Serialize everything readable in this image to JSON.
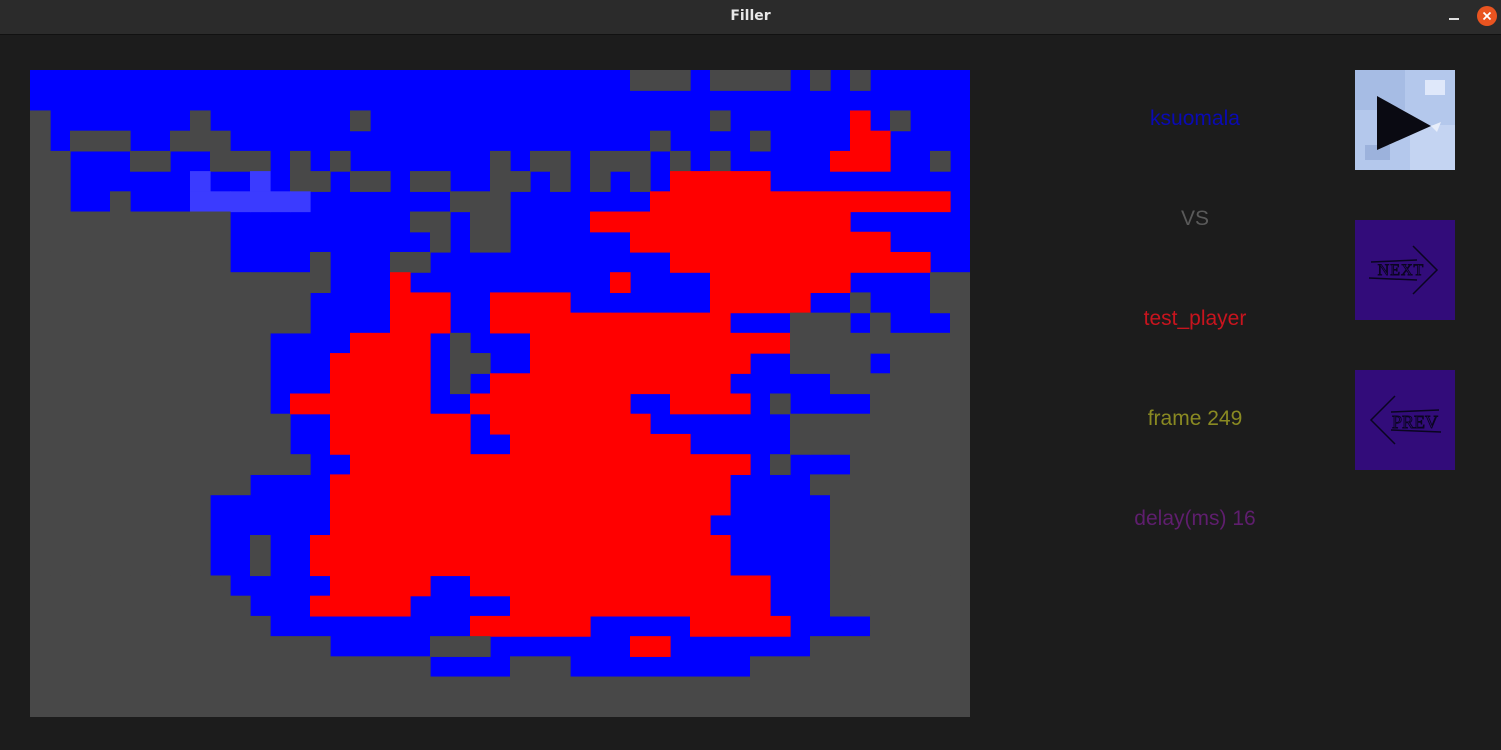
{
  "window": {
    "title": "Filler"
  },
  "board": {
    "columns": 47,
    "rows": 32,
    "colors": {
      "empty": "#484848",
      "player1": "#0000ff",
      "player2": "#ff0000",
      "last_piece": "#3b3bff"
    },
    "grid": [
      "..............................GGG.GGGG.G.G.....",
      "...............................................",
      "G.......G.......G.................G......R.G...",
      "G.GGG..GGG.....................G....G....RR....",
      "GG...GG..GGG.G.G.......G.GG.GGG.G.G.....RRR..G.",
      "GG......L..L.GG.GG.GG..GG.G.G.G.RRRRR..........",
      "GG..G...LLLLLL.......GGG.......RRRRRRRRRRRRRRR..",
      "GGGGGGGGGG.........GG.GG....RRRRRRRRRRRRR......",
      "GGGGGGGGGG..........G.GG......RRRRRRRRRRRRR....G",
      "GGGGGGGGGG....G...GG............RRRRRRRRRRRRR..G",
      "GGGGGGGGGGGGGGG...R..........R....RRRRRRR....GG",
      "GGGGGGGGGGGGGG....RRR..RRRR.......RRRRR..G...GG",
      "GGGGGGGGGGGGGG....RRR..RRRRRRRRRRRR...GGG.G...G",
      "GGGGGGGGGGGG....RRRR.G...RRRRRRRRRRRRRGGGGGGGGG",
      "GGGGGGGGGGGG...RRRRR.GG..RRRRRRRRRRR..GGGG.GGGG",
      "GGGGGGGGGGGG...RRRRR.G.RRRRRRRRRRRR.....GGGGGGG",
      "GGGGGGGGGGGG.RRRRRRR..RRRRRRRR..RRRR.G....GGGGG",
      "GGGGGGGGGGGGG..RRRRRRR.RRRRRRRR.......GGGGGGGGG",
      "GGGGGGGGGGGGG..RRRRRRR..RRRRRRRRR.....GGGGGGGGG",
      "GGGGGGGGGGGGGG..RRRRRRRRRRRRRRRRRRRR.G...GGGGGG",
      "GGGGGGGGGGG....RRRRRRRRRRRRRRRRRRRR....GGGGGGGG",
      "GGGGGGGGG......RRRRRRRRRRRRRRRRRRRR.....GGGGGGG",
      "GGGGGGGGG......RRRRRRRRRRRRRRRRRRR......GGGGGGG",
      "GGGGGGGGG..G..RRRRRRRRRRRRRRRRRRRRR.....GGGGGGG",
      "GGGGGGGGG..G..RRRRRRRRRRRRRRRRRRRRR.....GGGGGGG",
      "GGGGGGGGGG.....RRRRR..RRRRRRRRRRRRRRR...GGGGGGGG",
      "GGGGGGGGGGG...RRRRR.....RRRRRRRRRRRRR...GGGGGGGG",
      "GGGGGGGGGGGG..........RRRRRR.....RRRRR....GGGGG",
      "GGGGGGGGGGGGGGG.....GGG.......RR.......GGGGGGGGG",
      "GGGGGGGGGGGGGGGGGGGG....GGG.........GGGGGGGGGGG",
      "GGGGGGGGGGGGGGGGGGGGGGGGGGGGGGGGGGGGGGGGGGGGGGG",
      "GGGGGGGGGGGGGGGGGGGGGGGGGGGGGGGGGGGGGGGGGGGGGGG"
    ]
  },
  "players": {
    "player1": {
      "name": "ksuomala",
      "color": "#0a0ab4"
    },
    "versus": {
      "text": "VS",
      "color": "#5a5a5a"
    },
    "player2": {
      "name": "test_player",
      "color": "#c8141e"
    }
  },
  "status": {
    "frame": "frame 249",
    "frame_color": "#8a8a22",
    "delay": "delay(ms) 16",
    "delay_color": "#5f1e6e"
  },
  "controls": {
    "play": {
      "icon": "play-icon"
    },
    "next": {
      "label": "NEXT",
      "icon": "next-arrow-icon"
    },
    "prev": {
      "label": "PREV",
      "icon": "prev-arrow-icon"
    }
  }
}
